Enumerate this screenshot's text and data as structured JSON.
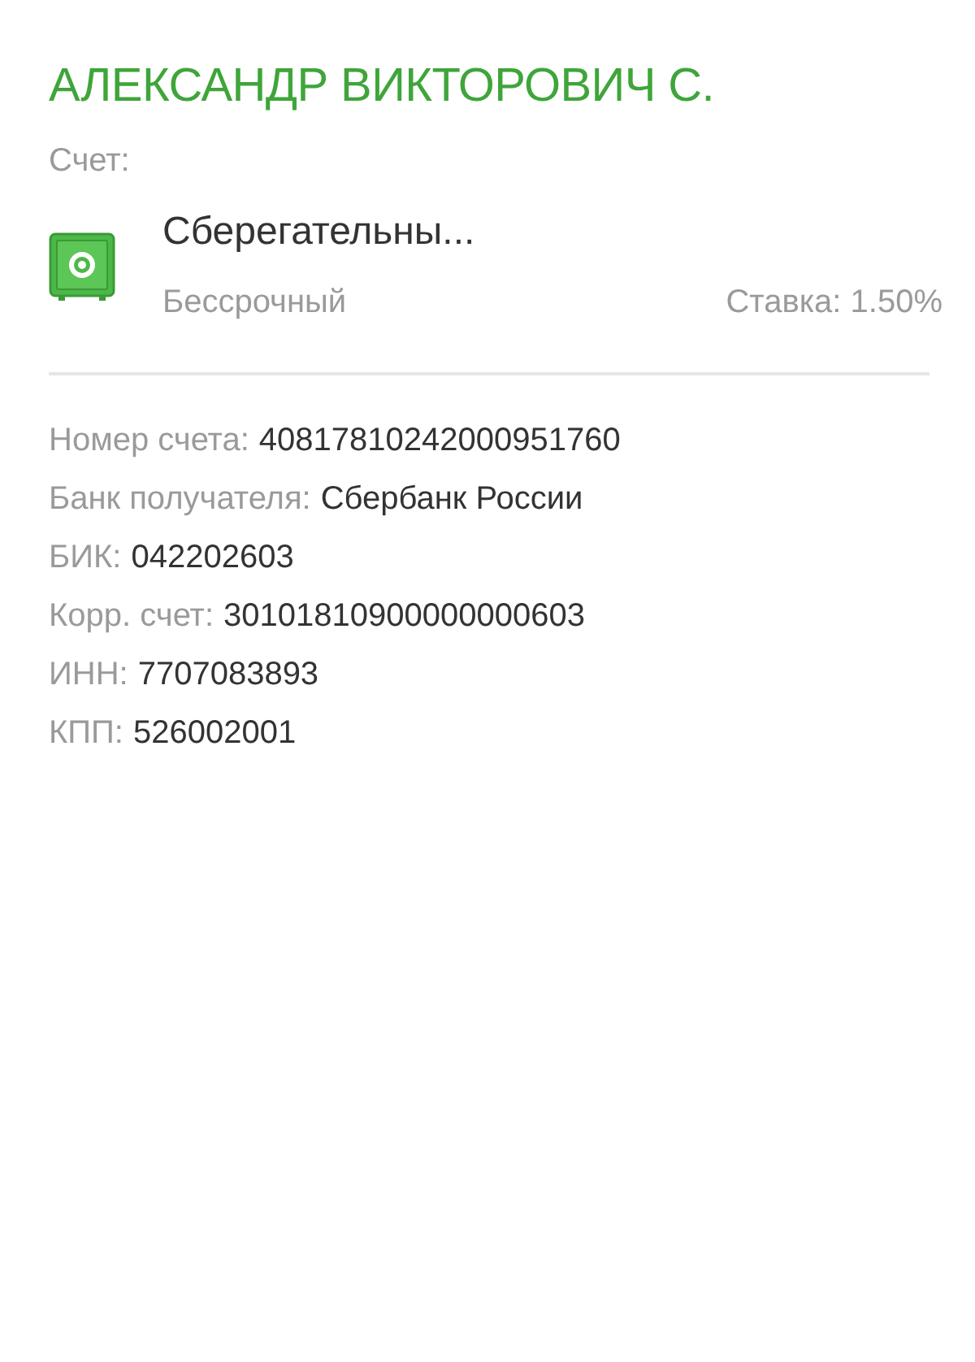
{
  "recipient": {
    "name": "АЛЕКСАНДР ВИКТОРОВИЧ С."
  },
  "account_label": "Счет:",
  "account": {
    "name": "Сберегательны...",
    "term": "Бессрочный",
    "rate": "Ставка: 1.50%"
  },
  "details": [
    {
      "label": "Номер счета:",
      "value": "40817810242000951760"
    },
    {
      "label": "Банк получателя:",
      "value": "Сбербанк России"
    },
    {
      "label": "БИК:",
      "value": "042202603"
    },
    {
      "label": "Корр. счет:",
      "value": "30101810900000000603"
    },
    {
      "label": "ИНН:",
      "value": "7707083893"
    },
    {
      "label": "КПП:",
      "value": "526002001"
    }
  ]
}
